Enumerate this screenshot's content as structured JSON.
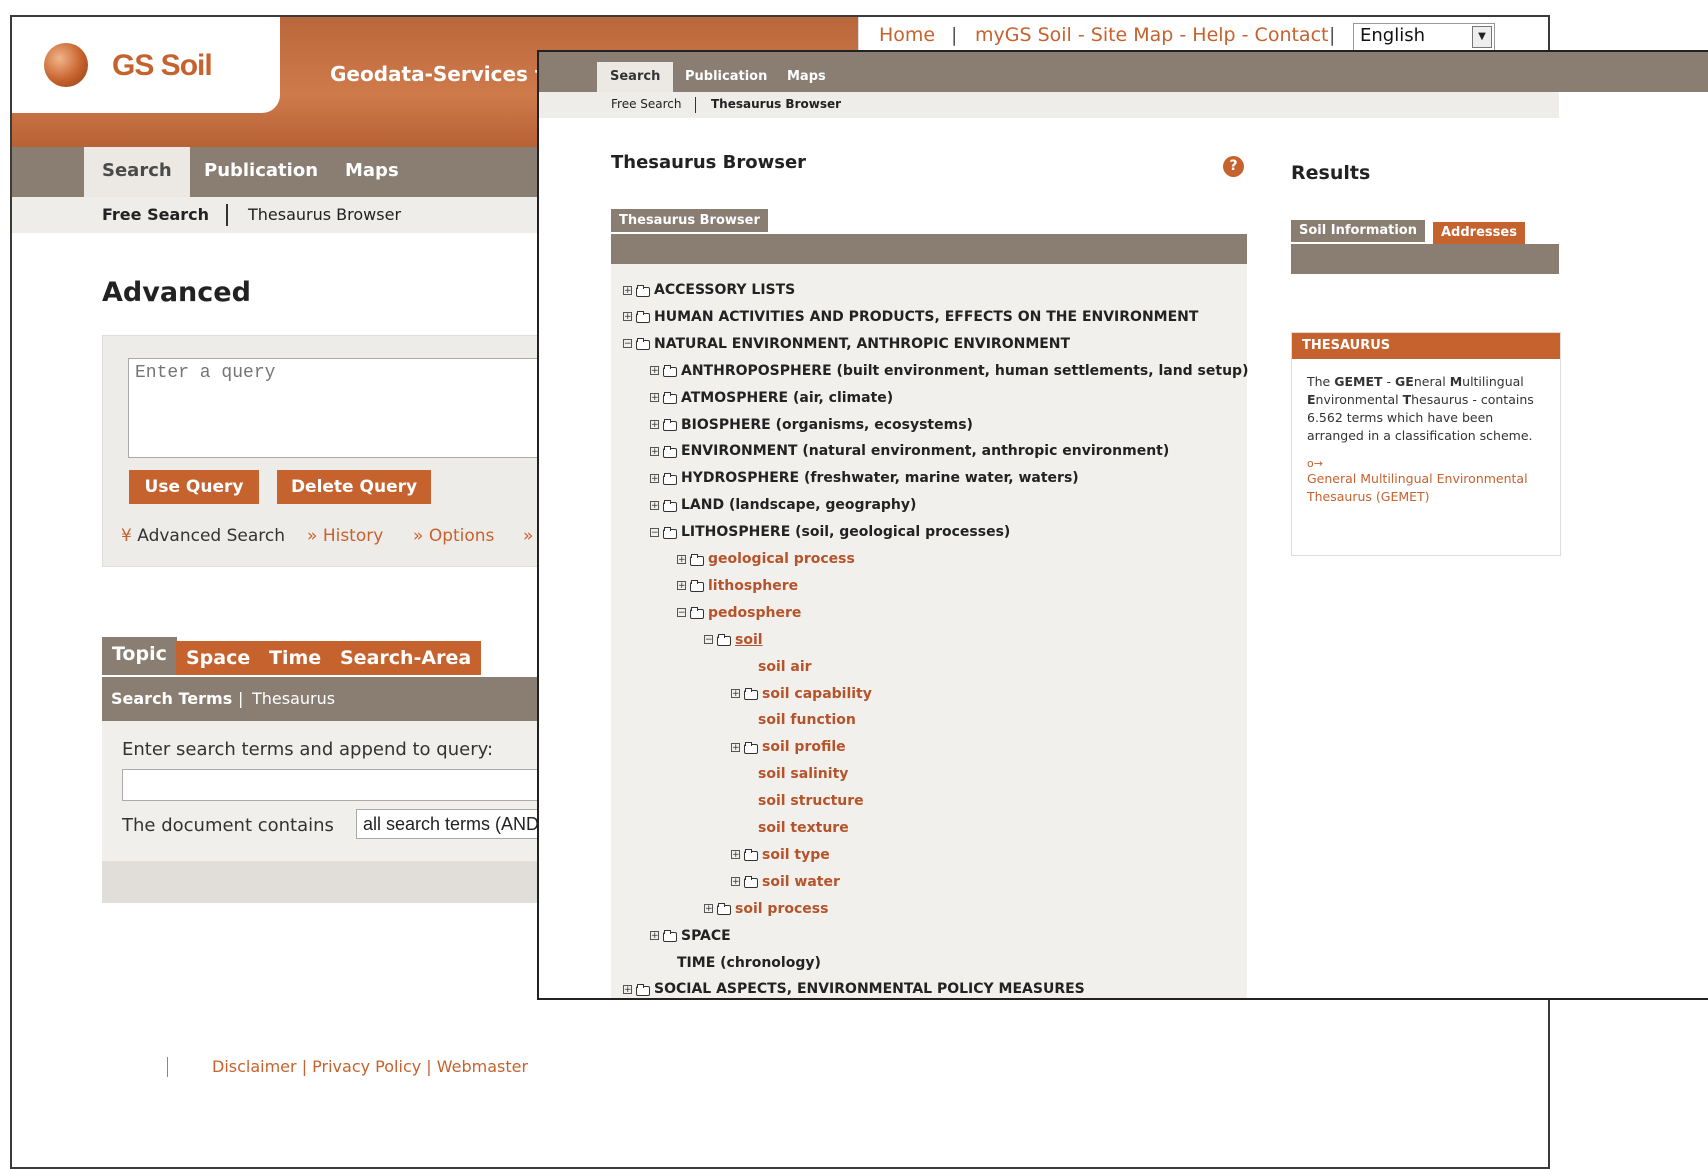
{
  "site": {
    "logo": "GS Soil",
    "tagline": "Geodata-Services for Eur",
    "topnav": [
      "Home",
      "myGS Soil - Site Map - Help - Contact"
    ],
    "language": "English"
  },
  "main_nav": [
    "Search",
    "Publication",
    "Maps"
  ],
  "sub_nav": [
    "Free Search",
    "Thesaurus Browser"
  ],
  "advanced": {
    "title": "Advanced",
    "query_placeholder": "Enter a query",
    "use_query": "Use Query",
    "delete_query": "Delete Query",
    "links": {
      "advanced_search": "Advanced Search",
      "history": "History",
      "options": "Options",
      "more": "»"
    },
    "tabs": [
      "Topic",
      "Space",
      "Time",
      "Search-Area"
    ],
    "search_terms_tab": "Search Terms",
    "thesaurus_tab": "Thesaurus",
    "enter_terms_label": "Enter search terms and append to query:",
    "contains_label": "The document contains",
    "contains_value": "all search terms (AND"
  },
  "footer": "Disclaimer | Privacy Policy | Webmaster",
  "thesaurus_window": {
    "nav": [
      "Search",
      "Publication",
      "Maps"
    ],
    "sub_nav": [
      "Free Search",
      "Thesaurus Browser"
    ],
    "title": "Thesaurus Browser",
    "help": "?",
    "tab": "Thesaurus Browser",
    "tree": [
      {
        "label": "ACCESSORY LISTS",
        "level": 0,
        "toggle": "+",
        "folder": true,
        "style": "dark"
      },
      {
        "label": "HUMAN ACTIVITIES AND PRODUCTS, EFFECTS ON THE ENVIRONMENT",
        "level": 0,
        "toggle": "+",
        "folder": true,
        "style": "dark"
      },
      {
        "label": "NATURAL ENVIRONMENT, ANTHROPIC ENVIRONMENT",
        "level": 0,
        "toggle": "−",
        "folder": true,
        "style": "dark"
      },
      {
        "label": "ANTHROPOSPHERE (built environment, human settlements, land setup)",
        "level": 1,
        "toggle": "+",
        "folder": true,
        "style": "dark"
      },
      {
        "label": "ATMOSPHERE (air, climate)",
        "level": 1,
        "toggle": "+",
        "folder": true,
        "style": "dark"
      },
      {
        "label": "BIOSPHERE (organisms, ecosystems)",
        "level": 1,
        "toggle": "+",
        "folder": true,
        "style": "dark"
      },
      {
        "label": "ENVIRONMENT (natural environment, anthropic environment)",
        "level": 1,
        "toggle": "+",
        "folder": true,
        "style": "dark"
      },
      {
        "label": "HYDROSPHERE (freshwater, marine water, waters)",
        "level": 1,
        "toggle": "+",
        "folder": true,
        "style": "dark"
      },
      {
        "label": "LAND (landscape, geography)",
        "level": 1,
        "toggle": "+",
        "folder": true,
        "style": "dark"
      },
      {
        "label": "LITHOSPHERE (soil, geological processes)",
        "level": 1,
        "toggle": "−",
        "folder": true,
        "style": "dark"
      },
      {
        "label": "geological process",
        "level": 2,
        "toggle": "+",
        "folder": true,
        "style": "orange"
      },
      {
        "label": "lithosphere",
        "level": 2,
        "toggle": "+",
        "folder": true,
        "style": "orange"
      },
      {
        "label": "pedosphere",
        "level": 2,
        "toggle": "−",
        "folder": true,
        "style": "orange"
      },
      {
        "label": "soil",
        "level": 3,
        "toggle": "−",
        "folder": true,
        "style": "orange-underline"
      },
      {
        "label": "soil air",
        "level": 4,
        "toggle": "",
        "folder": false,
        "style": "orange"
      },
      {
        "label": "soil capability",
        "level": 4,
        "toggle": "+",
        "folder": true,
        "style": "orange"
      },
      {
        "label": "soil function",
        "level": 4,
        "toggle": "",
        "folder": false,
        "style": "orange"
      },
      {
        "label": "soil profile",
        "level": 4,
        "toggle": "+",
        "folder": true,
        "style": "orange"
      },
      {
        "label": "soil salinity",
        "level": 4,
        "toggle": "",
        "folder": false,
        "style": "orange"
      },
      {
        "label": "soil structure",
        "level": 4,
        "toggle": "",
        "folder": false,
        "style": "orange"
      },
      {
        "label": "soil texture",
        "level": 4,
        "toggle": "",
        "folder": false,
        "style": "orange"
      },
      {
        "label": "soil type",
        "level": 4,
        "toggle": "+",
        "folder": true,
        "style": "orange"
      },
      {
        "label": "soil water",
        "level": 4,
        "toggle": "+",
        "folder": true,
        "style": "orange"
      },
      {
        "label": "soil process",
        "level": 3,
        "toggle": "+",
        "folder": true,
        "style": "orange"
      },
      {
        "label": "SPACE",
        "level": 1,
        "toggle": "+",
        "folder": true,
        "style": "dark"
      },
      {
        "label": "TIME (chronology)",
        "level": 1,
        "toggle": "",
        "folder": false,
        "style": "dark"
      },
      {
        "label": "SOCIAL ASPECTS, ENVIRONMENTAL POLICY MEASURES",
        "level": 0,
        "toggle": "+",
        "folder": true,
        "style": "dark"
      }
    ],
    "results": {
      "title": "Results",
      "tabs": [
        "Soil Information",
        "Addresses"
      ],
      "thesaurus_heading": "THESAURUS",
      "desc_parts": [
        "The ",
        "GEMET",
        " - ",
        "GE",
        "neral ",
        "M",
        "ultilingual ",
        "E",
        "nvironmental ",
        "T",
        "hesaurus - contains 6.562 terms which have been arranged in a classification scheme."
      ],
      "link_icon": "o→",
      "link": "General Multilingual Environmental Thesaurus (GEMET)"
    }
  },
  "colors": {
    "accent": "#c6622d",
    "nav": "#8a7d72",
    "panel": "#efedea"
  }
}
